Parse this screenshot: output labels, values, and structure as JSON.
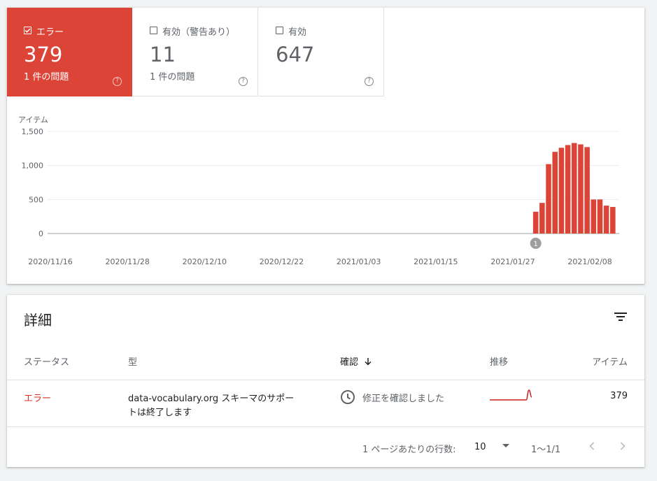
{
  "tiles": [
    {
      "label": "エラー",
      "value": "379",
      "sub": "1 件の問題",
      "checked": true
    },
    {
      "label": "有効（警告あり）",
      "value": "11",
      "sub": "1 件の問題",
      "checked": false
    },
    {
      "label": "有効",
      "value": "647",
      "sub": "",
      "checked": false
    }
  ],
  "chart_data": {
    "type": "bar",
    "ylabel": "アイテム",
    "ylim": [
      0,
      1500
    ],
    "yticks": [
      "1,500",
      "1,000",
      "500",
      "0"
    ],
    "ytick_values": [
      1500,
      1000,
      500,
      0
    ],
    "xticks": [
      "2020/11/16",
      "2020/11/28",
      "2020/12/10",
      "2020/12/22",
      "2021/01/03",
      "2021/01/15",
      "2021/01/27",
      "2021/02/08"
    ],
    "x_start": "2020/11/16",
    "x_end": "2021/02/13",
    "series": [
      {
        "color": "#db4437",
        "x": [
          "2021/01/31",
          "2021/02/01",
          "2021/02/02",
          "2021/02/03",
          "2021/02/04",
          "2021/02/05",
          "2021/02/06",
          "2021/02/07",
          "2021/02/08",
          "2021/02/09",
          "2021/02/10",
          "2021/02/11",
          "2021/02/12"
        ],
        "values": [
          320,
          450,
          1020,
          1200,
          1260,
          1300,
          1330,
          1310,
          1270,
          500,
          500,
          410,
          390
        ]
      }
    ],
    "annotation": {
      "label": "1",
      "date": "2021/01/31"
    }
  },
  "details": {
    "title": "詳細",
    "columns": {
      "status": "ステータス",
      "type": "型",
      "validation": "確認",
      "trend": "推移",
      "items": "アイテム"
    },
    "rows": [
      {
        "status": "エラー",
        "type_line1": "data-vocabulary.org スキーマのサポー",
        "type_line2": "トは終了します",
        "validation": "修正を確認しました",
        "items": "379"
      }
    ],
    "footer": {
      "rows_per_page_label": "1 ページあたりの行数:",
      "rows_per_page": "10",
      "range": "1〜1/1"
    }
  },
  "colors": {
    "error": "#db4437",
    "error_text": "#d93025"
  }
}
